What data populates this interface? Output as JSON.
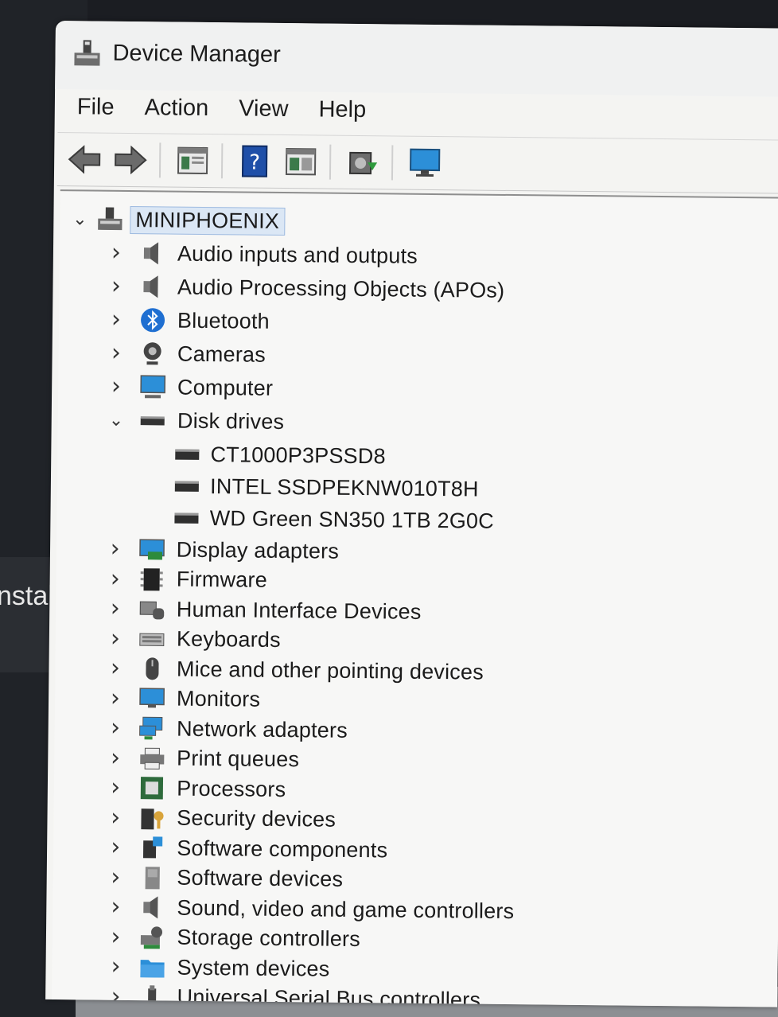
{
  "background": {
    "partial_text": "nstalle"
  },
  "window": {
    "title": "Device Manager"
  },
  "menu": [
    "File",
    "Action",
    "View",
    "Help"
  ],
  "toolbar": {
    "buttons": [
      "back-icon",
      "forward-icon",
      "properties-icon",
      "help-icon",
      "update-driver-icon",
      "scan-hardware-icon",
      "monitor-icon"
    ]
  },
  "tree": {
    "root": "MINIPHOENIX",
    "categories": [
      {
        "label": "Audio inputs and outputs",
        "icon": "speaker-icon",
        "expanded": false
      },
      {
        "label": "Audio Processing Objects (APOs)",
        "icon": "speaker-icon",
        "expanded": false
      },
      {
        "label": "Bluetooth",
        "icon": "bluetooth-icon",
        "expanded": false
      },
      {
        "label": "Cameras",
        "icon": "camera-icon",
        "expanded": false
      },
      {
        "label": "Computer",
        "icon": "computer-icon",
        "expanded": false
      },
      {
        "label": "Disk drives",
        "icon": "disk-icon",
        "expanded": true,
        "children": [
          "CT1000P3PSSD8",
          "INTEL SSDPEKNW010T8H",
          "WD Green SN350 1TB 2G0C"
        ]
      },
      {
        "label": "Display adapters",
        "icon": "display-adapter-icon",
        "expanded": false
      },
      {
        "label": "Firmware",
        "icon": "firmware-icon",
        "expanded": false
      },
      {
        "label": "Human Interface Devices",
        "icon": "hid-icon",
        "expanded": false
      },
      {
        "label": "Keyboards",
        "icon": "keyboard-icon",
        "expanded": false
      },
      {
        "label": "Mice and other pointing devices",
        "icon": "mouse-icon",
        "expanded": false
      },
      {
        "label": "Monitors",
        "icon": "monitor-icon",
        "expanded": false
      },
      {
        "label": "Network adapters",
        "icon": "network-icon",
        "expanded": false
      },
      {
        "label": "Print queues",
        "icon": "printer-icon",
        "expanded": false
      },
      {
        "label": "Processors",
        "icon": "processor-icon",
        "expanded": false
      },
      {
        "label": "Security devices",
        "icon": "security-icon",
        "expanded": false
      },
      {
        "label": "Software components",
        "icon": "software-component-icon",
        "expanded": false
      },
      {
        "label": "Software devices",
        "icon": "software-device-icon",
        "expanded": false
      },
      {
        "label": "Sound, video and game controllers",
        "icon": "speaker-icon",
        "expanded": false
      },
      {
        "label": "Storage controllers",
        "icon": "storage-controller-icon",
        "expanded": false
      },
      {
        "label": "System devices",
        "icon": "system-folder-icon",
        "expanded": false
      },
      {
        "label": "Universal Serial Bus controllers",
        "icon": "usb-icon",
        "expanded": false
      }
    ]
  }
}
